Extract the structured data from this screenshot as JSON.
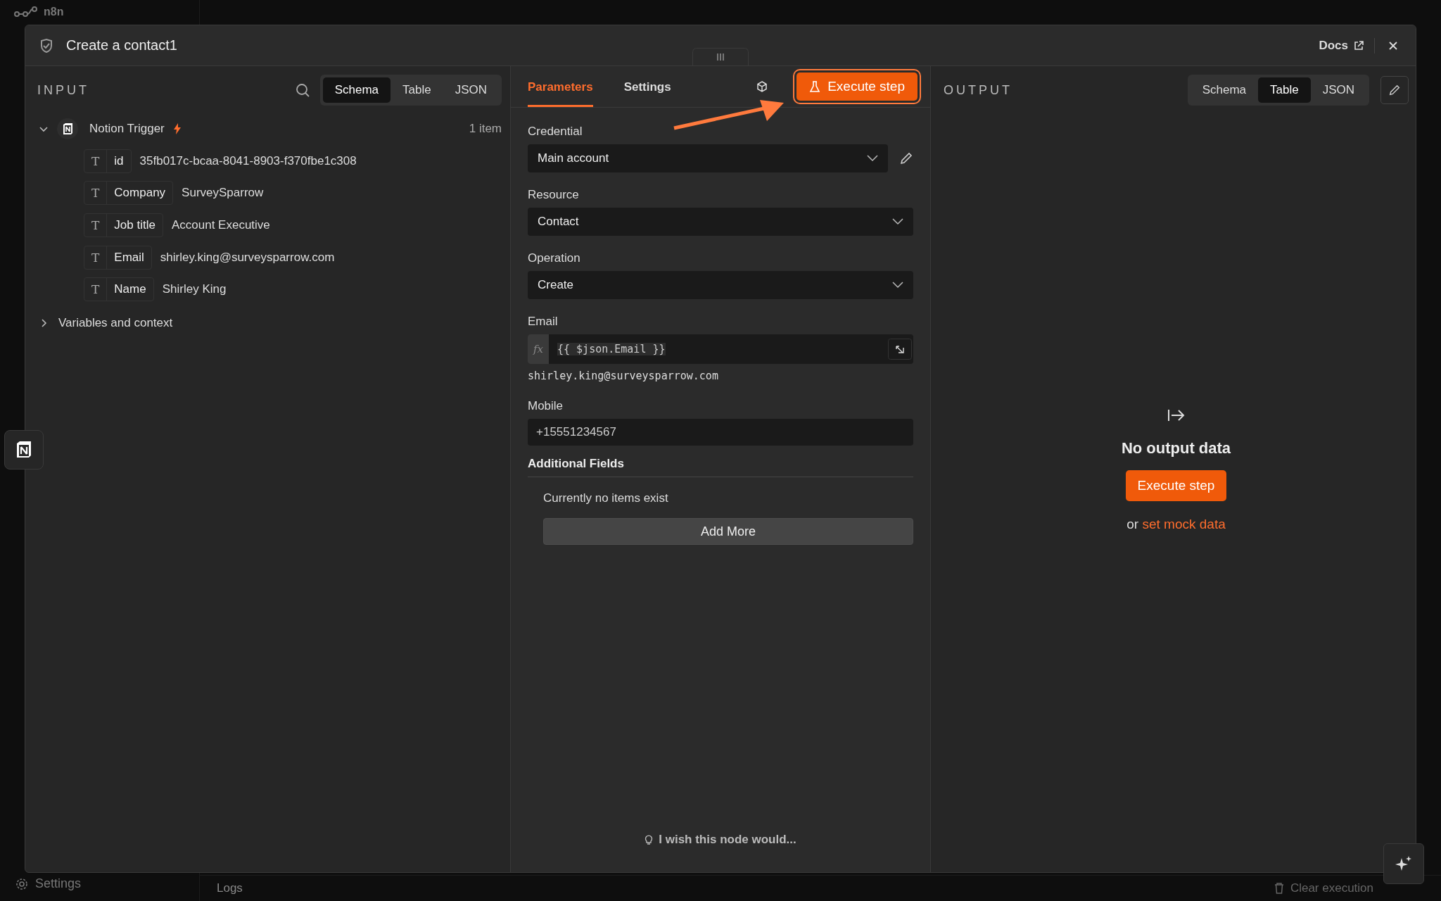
{
  "background": {
    "app_name": "n8n",
    "sidebar_footer": "Settings",
    "logs_label": "Logs",
    "clear_execution": "Clear execution"
  },
  "window": {
    "title": "Create a contact1",
    "docs_link": "Docs"
  },
  "input": {
    "heading": "INPUT",
    "view_tabs": [
      {
        "label": "Schema",
        "selected": true
      },
      {
        "label": "Table",
        "selected": false
      },
      {
        "label": "JSON",
        "selected": false
      }
    ],
    "node": {
      "name": "Notion Trigger",
      "expanded": true,
      "item_count": "1 item",
      "fields": [
        {
          "type_symbol": "T",
          "key": "id",
          "value": "35fb017c-bcaa-8041-8903-f370fbe1c308"
        },
        {
          "type_symbol": "T",
          "key": "Company",
          "value": "SurveySparrow"
        },
        {
          "type_symbol": "T",
          "key": "Job title",
          "value": "Account Executive"
        },
        {
          "type_symbol": "T",
          "key": "Email",
          "value": "shirley.king@surveysparrow.com"
        },
        {
          "type_symbol": "T",
          "key": "Name",
          "value": "Shirley King"
        }
      ]
    },
    "context": {
      "label": "Variables and context",
      "expanded": false
    }
  },
  "parameters": {
    "tabs": [
      {
        "label": "Parameters",
        "selected": true
      },
      {
        "label": "Settings",
        "selected": false
      }
    ],
    "execute_button": "Execute step",
    "credential": {
      "label": "Credential",
      "value": "Main account"
    },
    "resource": {
      "label": "Resource",
      "value": "Contact"
    },
    "operation": {
      "label": "Operation",
      "value": "Create"
    },
    "email": {
      "label": "Email",
      "fx": "fx",
      "expression": "{{ $json.Email }}",
      "preview": "shirley.king@surveysparrow.com"
    },
    "mobile": {
      "label": "Mobile",
      "value": "+15551234567"
    },
    "additional_fields": {
      "label": "Additional Fields",
      "empty_text": "Currently no items exist",
      "add_button": "Add More"
    },
    "feedback": "I wish this node would..."
  },
  "output": {
    "heading": "OUTPUT",
    "view_tabs": [
      {
        "label": "Schema",
        "selected": false
      },
      {
        "label": "Table",
        "selected": true
      },
      {
        "label": "JSON",
        "selected": false
      }
    ],
    "empty_title": "No output data",
    "execute_button": "Execute step",
    "mock_prefix": "or",
    "mock_link": "set mock data"
  }
}
